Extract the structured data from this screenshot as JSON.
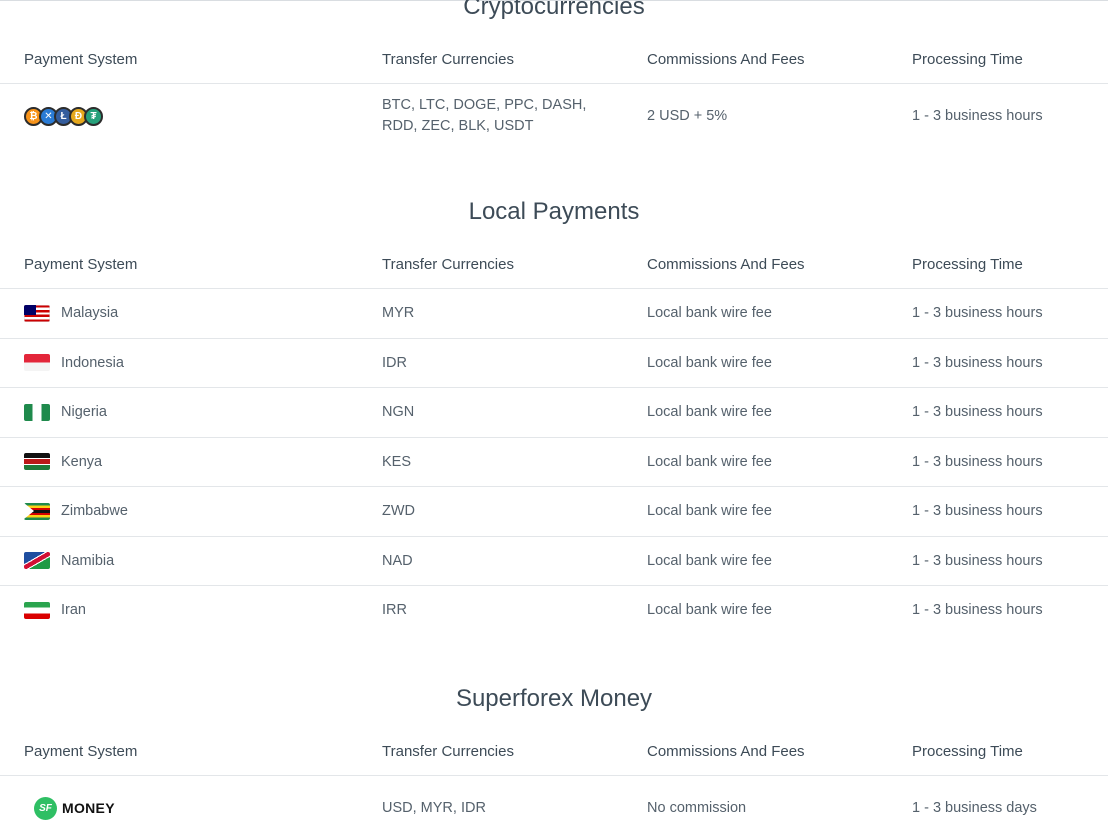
{
  "columns": {
    "payment_system": "Payment System",
    "transfer_currencies": "Transfer Currencies",
    "commissions": "Commissions And Fees",
    "processing_time": "Processing Time"
  },
  "crypto": {
    "title": "Cryptocurrencies",
    "coins": [
      {
        "icon": "bitcoin-icon",
        "glyph": "₿",
        "color": "#f7931a"
      },
      {
        "icon": "ripple-icon",
        "glyph": "✕",
        "color": "#2a7bd5"
      },
      {
        "icon": "litecoin-icon",
        "glyph": "Ł",
        "color": "#345d9d"
      },
      {
        "icon": "dogecoin-icon",
        "glyph": "Ð",
        "color": "#e6a81c"
      },
      {
        "icon": "tether-icon",
        "glyph": "₮",
        "color": "#26a17b"
      }
    ],
    "currencies_line1": "BTC, LTC, DOGE, PPC, DASH,",
    "currencies_line2": "RDD, ZEC, BLK, USDT",
    "commission": "2 USD + 5%",
    "time": "1 - 3 business hours"
  },
  "local": {
    "title": "Local Payments",
    "rows": [
      {
        "country": "Malaysia",
        "currency": "MYR",
        "fee": "Local bank wire fee",
        "time": "1 - 3 business hours",
        "flag": "malaysia-flag-icon"
      },
      {
        "country": "Indonesia",
        "currency": "IDR",
        "fee": "Local bank wire fee",
        "time": "1 - 3 business hours",
        "flag": "indonesia-flag-icon"
      },
      {
        "country": "Nigeria",
        "currency": "NGN",
        "fee": "Local bank wire fee",
        "time": "1 - 3 business hours",
        "flag": "nigeria-flag-icon"
      },
      {
        "country": "Kenya",
        "currency": "KES",
        "fee": "Local bank wire fee",
        "time": "1 - 3 business hours",
        "flag": "kenya-flag-icon"
      },
      {
        "country": "Zimbabwe",
        "currency": "ZWD",
        "fee": "Local bank wire fee",
        "time": "1 - 3 business hours",
        "flag": "zimbabwe-flag-icon"
      },
      {
        "country": "Namibia",
        "currency": "NAD",
        "fee": "Local bank wire fee",
        "time": "1 - 3 business hours",
        "flag": "namibia-flag-icon"
      },
      {
        "country": "Iran",
        "currency": "IRR",
        "fee": "Local bank wire fee",
        "time": "1 - 3 business hours",
        "flag": "iran-flag-icon"
      }
    ]
  },
  "sfmoney": {
    "title": "Superforex Money",
    "logo_badge": "SF",
    "logo_word": "MONEY",
    "currencies": "USD, MYR, IDR",
    "commission": "No commission",
    "time": "1 - 3 business days"
  }
}
